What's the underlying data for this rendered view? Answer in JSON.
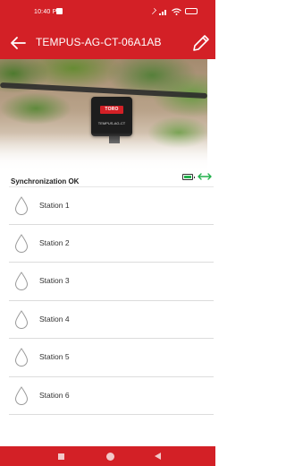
{
  "status_bar": {
    "time": "10:40 PM"
  },
  "app_bar": {
    "title": "TEMPUS-AG-CT-06A1AB",
    "back_icon": "arrow-left-icon",
    "edit_icon": "pencil-icon"
  },
  "hero": {
    "device_brand": "TORO",
    "device_model": "TEMPUS-AG-CT"
  },
  "sync": {
    "status_text": "Synchronization OK",
    "battery_icon": "battery-icon",
    "connection_icon": "link-arrows-icon"
  },
  "stations": [
    {
      "label": "Station 1",
      "icon": "water-drop-icon"
    },
    {
      "label": "Station 2",
      "icon": "water-drop-icon"
    },
    {
      "label": "Station 3",
      "icon": "water-drop-icon"
    },
    {
      "label": "Station 4",
      "icon": "water-drop-icon"
    },
    {
      "label": "Station 5",
      "icon": "water-drop-icon"
    },
    {
      "label": "Station 6",
      "icon": "water-drop-icon"
    }
  ],
  "colors": {
    "brand_red": "#d32026",
    "status_green": "#22b14c"
  }
}
